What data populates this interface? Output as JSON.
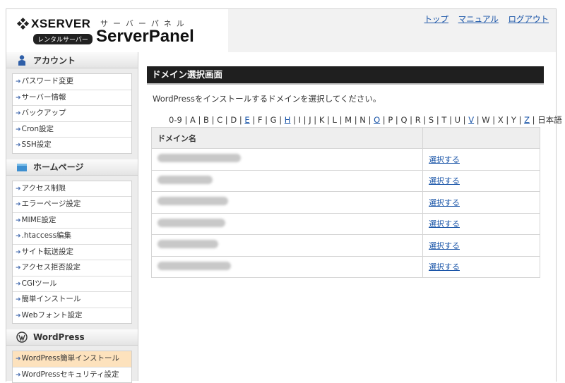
{
  "header": {
    "brand": "XSERVER",
    "brand_sub": "レンタルサーバー",
    "panel_kana": "サーバーパネル",
    "panel_title": "ServerPanel",
    "links": [
      "トップ",
      "マニュアル",
      "ログアウト"
    ]
  },
  "sidebar": {
    "account": {
      "title": "アカウント",
      "icon": "user-icon",
      "items": [
        "パスワード変更",
        "サーバー情報",
        "バックアップ",
        "Cron設定",
        "SSH設定"
      ]
    },
    "homepage": {
      "title": "ホームページ",
      "icon": "folder-icon",
      "items": [
        "アクセス制限",
        "エラーページ設定",
        "MIME設定",
        ".htaccess編集",
        "サイト転送設定",
        "アクセス拒否設定",
        "CGIツール",
        "簡単インストール",
        "Webフォント設定"
      ]
    },
    "wordpress": {
      "title": "WordPress",
      "icon": "wordpress-icon",
      "items": [
        "WordPress簡単インストール",
        "WordPressセキュリティ設定"
      ],
      "active_index": 0
    }
  },
  "main": {
    "page_title": "ドメイン選択画面",
    "instruction": "WordPressをインストールするドメインを選択してください。",
    "alpha_index": [
      {
        "t": "0-9",
        "link": false
      },
      {
        "t": "A",
        "link": false
      },
      {
        "t": "B",
        "link": false
      },
      {
        "t": "C",
        "link": false
      },
      {
        "t": "D",
        "link": false
      },
      {
        "t": "E",
        "link": true
      },
      {
        "t": "F",
        "link": false
      },
      {
        "t": "G",
        "link": false
      },
      {
        "t": "H",
        "link": true
      },
      {
        "t": "I",
        "link": false
      },
      {
        "t": "J",
        "link": false
      },
      {
        "t": "K",
        "link": false
      },
      {
        "t": "L",
        "link": false
      },
      {
        "t": "M",
        "link": false
      },
      {
        "t": "N",
        "link": false
      },
      {
        "t": "O",
        "link": true
      },
      {
        "t": "P",
        "link": false
      },
      {
        "t": "Q",
        "link": false
      },
      {
        "t": "R",
        "link": false
      },
      {
        "t": "S",
        "link": false
      },
      {
        "t": "T",
        "link": false
      },
      {
        "t": "U",
        "link": false
      },
      {
        "t": "V",
        "link": true
      },
      {
        "t": "W",
        "link": false
      },
      {
        "t": "X",
        "link": false
      },
      {
        "t": "Y",
        "link": false
      },
      {
        "t": "Z",
        "link": true
      },
      {
        "t": "日本語",
        "link": false
      }
    ],
    "table": {
      "col_domain": "ドメイン名",
      "col_action": "",
      "select_label": "選択する",
      "row_count": 6
    }
  },
  "colors": {
    "link": "#1a55a8",
    "header_bar": "#1f1f1f",
    "active_item": "#fde2bd"
  }
}
